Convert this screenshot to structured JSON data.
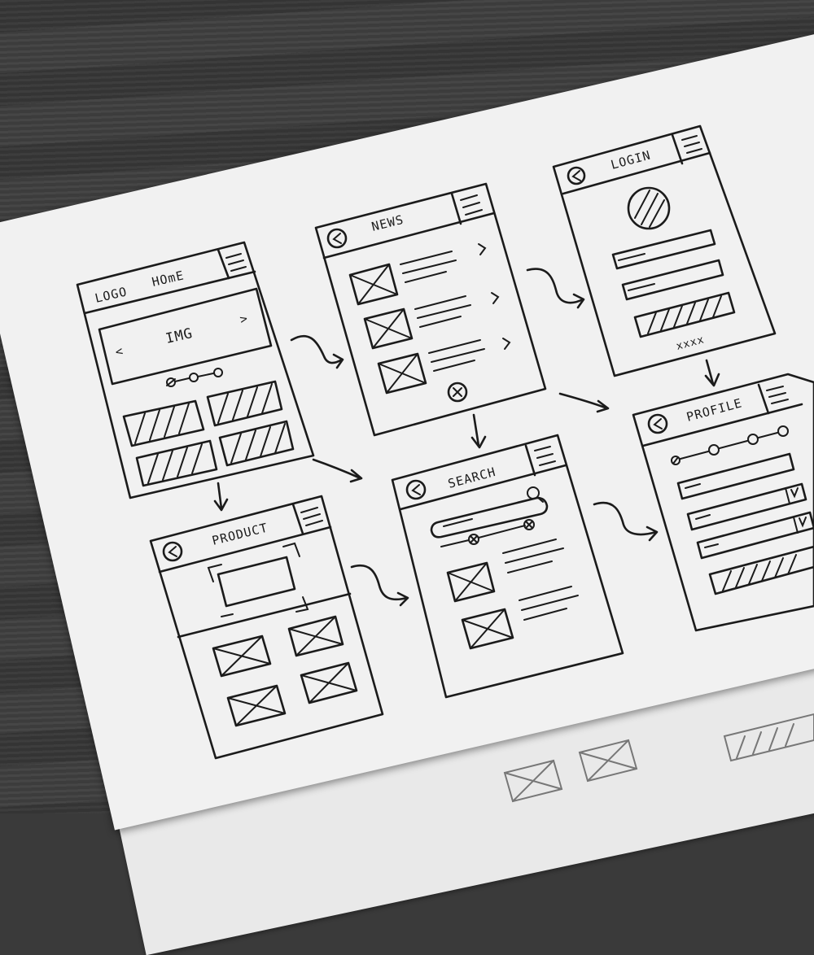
{
  "screens": {
    "home": {
      "logo": "LOGO",
      "title": "HOmE",
      "image": "IMG",
      "prev": "<",
      "next": ">"
    },
    "news": {
      "title": "NEWS"
    },
    "login": {
      "title": "LOGIN",
      "password_mask": "xxxx"
    },
    "product": {
      "title": "PRODUCT"
    },
    "search": {
      "title": "SEARCH"
    },
    "profile": {
      "title": "PROFILE"
    }
  }
}
